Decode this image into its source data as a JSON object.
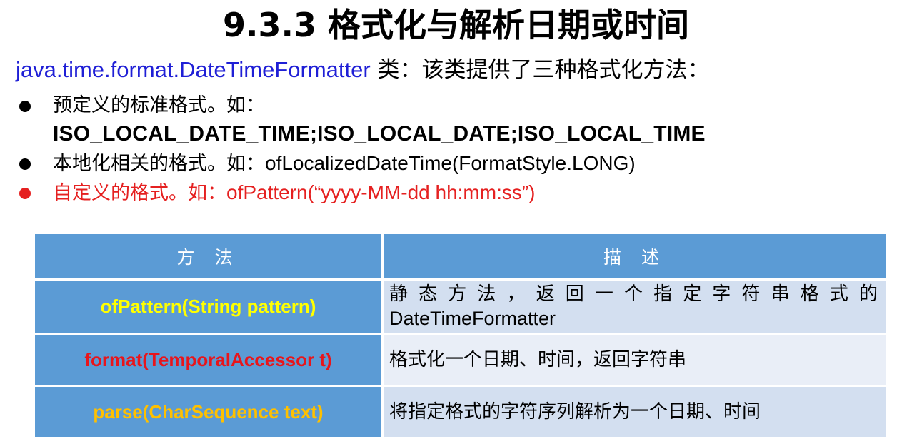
{
  "title": "9.3.3 格式化与解析日期或时间",
  "intro": {
    "class_name": "java.time.format.DateTimeFormatter",
    "text": " 类：该类提供了三种格式化方法："
  },
  "bullets": [
    {
      "text": "预定义的标准格式。如：",
      "detail": "ISO_LOCAL_DATE_TIME;ISO_LOCAL_DATE;ISO_LOCAL_TIME"
    },
    {
      "text": "本地化相关的格式。如：",
      "detail": "ofLocalizedDateTime(FormatStyle.LONG)"
    },
    {
      "text": "自定义的格式。如：",
      "detail": "ofPattern(“yyyy-MM-dd hh:mm:ss”)"
    }
  ],
  "table": {
    "headers": [
      "方 法",
      "描 述"
    ],
    "rows": [
      {
        "method": "ofPattern(String pattern)",
        "desc_line1": "静态方法，返回一个指定字符串格式的",
        "desc_line2": "DateTimeFormatter"
      },
      {
        "method": "format(TemporalAccessor t)",
        "desc": "格式化一个日期、时间，返回字符串"
      },
      {
        "method": "parse(CharSequence text)",
        "desc": "将指定格式的字符序列解析为一个日期、时间"
      }
    ]
  },
  "colors": {
    "intro_class": "#1f1fd6",
    "highlight_red": "#e52020",
    "method_1": "#ffff00",
    "method_2": "#e8151b",
    "method_3": "#ffc000",
    "table_header_bg": "#5b9bd5",
    "desc_bg": "#d3dff0",
    "desc_bg_alt": "#e9eef7"
  },
  "icons": {
    "bullet": "black-circle-bullet",
    "bullet_red": "red-circle-bullet"
  }
}
